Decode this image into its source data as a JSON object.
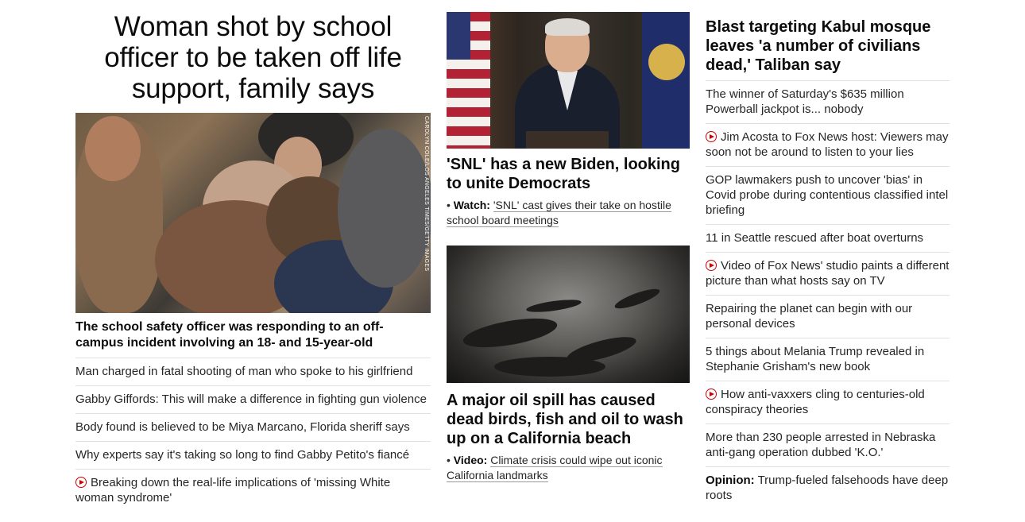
{
  "left": {
    "headline": "Woman shot by school officer to be taken off life support, family says",
    "photo_credit": "CAROLYN COLE/LOS ANGELES TIMES/GETTY IMAGES",
    "lead_caption": "The school safety officer was responding to an off-campus incident involving an 18- and 15-year-old",
    "items": [
      {
        "text": "Man charged in fatal shooting of man who spoke to his girlfriend",
        "video": false
      },
      {
        "text": "Gabby Giffords: This will make a difference in fighting gun violence",
        "video": false
      },
      {
        "text": "Body found is believed to be Miya Marcano, Florida sheriff says",
        "video": false
      },
      {
        "text": "Why experts say it's taking so long to find Gabby Petito's fiancé",
        "video": false
      },
      {
        "text": "Breaking down the real-life implications of 'missing White woman syndrome'",
        "video": true
      }
    ]
  },
  "middle": {
    "story1": {
      "headline": "'SNL' has a new Biden, looking to unite Democrats",
      "sub_label": "Watch:",
      "sub_text": "'SNL' cast gives their take on hostile school board meetings"
    },
    "story2": {
      "headline": "A major oil spill has caused dead birds, fish and oil to wash up on a California beach",
      "sub_label": "Video:",
      "sub_text": "Climate crisis could wipe out iconic California landmarks"
    }
  },
  "right": {
    "headline": "Blast targeting Kabul mosque leaves 'a number of civilians dead,' Taliban say",
    "items": [
      {
        "text": "The winner of Saturday's $635 million Powerball jackpot is... nobody",
        "video": false
      },
      {
        "text": "Jim Acosta to Fox News host: Viewers may soon not be around to listen to your lies",
        "video": true
      },
      {
        "text": "GOP lawmakers push to uncover 'bias' in Covid probe during contentious classified intel briefing",
        "video": false
      },
      {
        "text": "11 in Seattle rescued after boat overturns",
        "video": false
      },
      {
        "text": "Video of Fox News' studio paints a different picture than what hosts say on TV",
        "video": true
      },
      {
        "text": "Repairing the planet can begin with our personal devices",
        "video": false
      },
      {
        "text": "5 things about Melania Trump revealed in Stephanie Grisham's new book",
        "video": false
      },
      {
        "text": "How anti-vaxxers cling to centuries-old conspiracy theories",
        "video": true
      },
      {
        "text": "More than 230 people arrested in Nebraska anti-gang operation dubbed 'K.O.'",
        "video": false
      }
    ],
    "opinion_label": "Opinion:",
    "opinion_text": "Trump-fueled falsehoods have deep roots"
  },
  "colors": {
    "video_red": "#cc0000",
    "text": "#0c0c0c",
    "divider": "#e1e1e1"
  },
  "icons": {
    "video": "play-circle-icon"
  }
}
